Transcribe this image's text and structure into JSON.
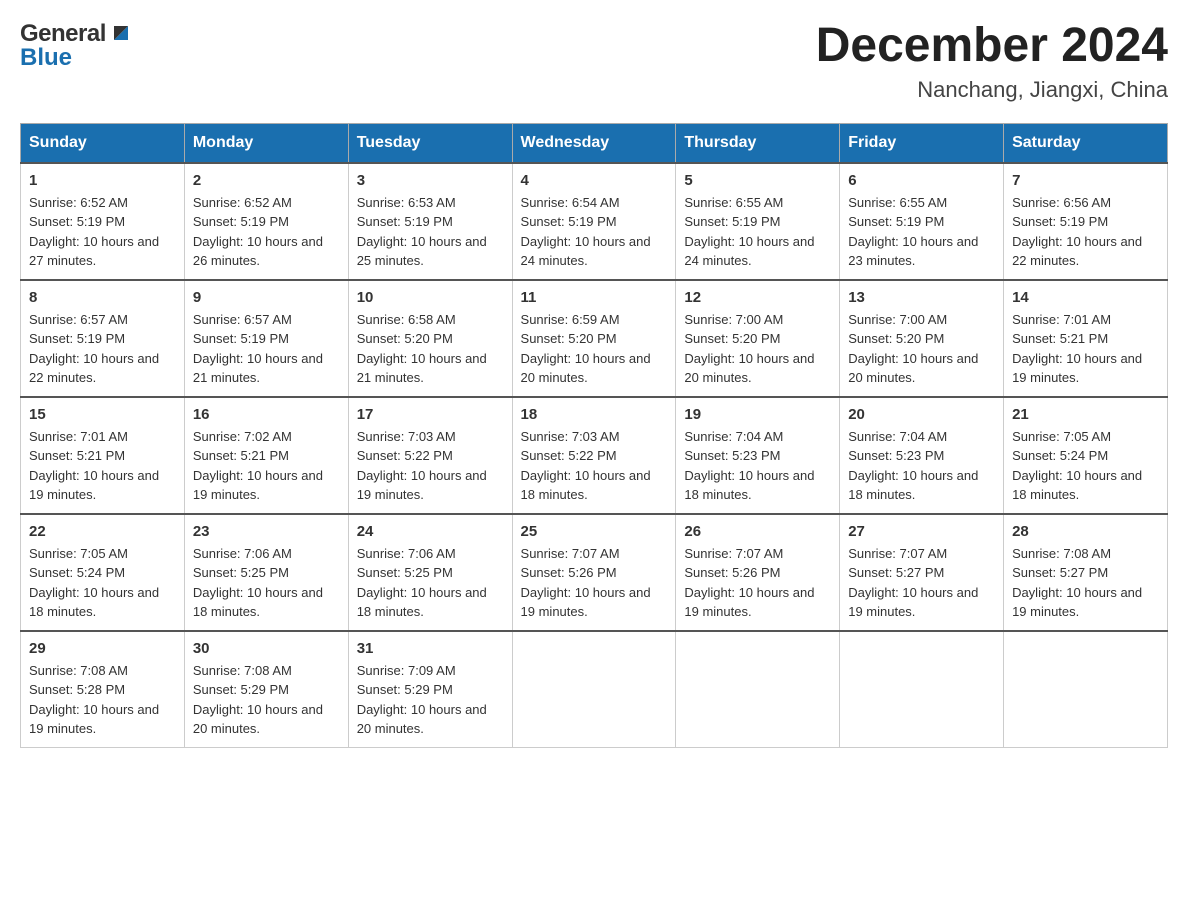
{
  "header": {
    "logo": {
      "general": "General",
      "arrow_symbol": "▶",
      "blue": "Blue"
    },
    "title": "December 2024",
    "location": "Nanchang, Jiangxi, China"
  },
  "calendar": {
    "days_of_week": [
      "Sunday",
      "Monday",
      "Tuesday",
      "Wednesday",
      "Thursday",
      "Friday",
      "Saturday"
    ],
    "weeks": [
      [
        {
          "day": "1",
          "sunrise": "Sunrise: 6:52 AM",
          "sunset": "Sunset: 5:19 PM",
          "daylight": "Daylight: 10 hours and 27 minutes."
        },
        {
          "day": "2",
          "sunrise": "Sunrise: 6:52 AM",
          "sunset": "Sunset: 5:19 PM",
          "daylight": "Daylight: 10 hours and 26 minutes."
        },
        {
          "day": "3",
          "sunrise": "Sunrise: 6:53 AM",
          "sunset": "Sunset: 5:19 PM",
          "daylight": "Daylight: 10 hours and 25 minutes."
        },
        {
          "day": "4",
          "sunrise": "Sunrise: 6:54 AM",
          "sunset": "Sunset: 5:19 PM",
          "daylight": "Daylight: 10 hours and 24 minutes."
        },
        {
          "day": "5",
          "sunrise": "Sunrise: 6:55 AM",
          "sunset": "Sunset: 5:19 PM",
          "daylight": "Daylight: 10 hours and 24 minutes."
        },
        {
          "day": "6",
          "sunrise": "Sunrise: 6:55 AM",
          "sunset": "Sunset: 5:19 PM",
          "daylight": "Daylight: 10 hours and 23 minutes."
        },
        {
          "day": "7",
          "sunrise": "Sunrise: 6:56 AM",
          "sunset": "Sunset: 5:19 PM",
          "daylight": "Daylight: 10 hours and 22 minutes."
        }
      ],
      [
        {
          "day": "8",
          "sunrise": "Sunrise: 6:57 AM",
          "sunset": "Sunset: 5:19 PM",
          "daylight": "Daylight: 10 hours and 22 minutes."
        },
        {
          "day": "9",
          "sunrise": "Sunrise: 6:57 AM",
          "sunset": "Sunset: 5:19 PM",
          "daylight": "Daylight: 10 hours and 21 minutes."
        },
        {
          "day": "10",
          "sunrise": "Sunrise: 6:58 AM",
          "sunset": "Sunset: 5:20 PM",
          "daylight": "Daylight: 10 hours and 21 minutes."
        },
        {
          "day": "11",
          "sunrise": "Sunrise: 6:59 AM",
          "sunset": "Sunset: 5:20 PM",
          "daylight": "Daylight: 10 hours and 20 minutes."
        },
        {
          "day": "12",
          "sunrise": "Sunrise: 7:00 AM",
          "sunset": "Sunset: 5:20 PM",
          "daylight": "Daylight: 10 hours and 20 minutes."
        },
        {
          "day": "13",
          "sunrise": "Sunrise: 7:00 AM",
          "sunset": "Sunset: 5:20 PM",
          "daylight": "Daylight: 10 hours and 20 minutes."
        },
        {
          "day": "14",
          "sunrise": "Sunrise: 7:01 AM",
          "sunset": "Sunset: 5:21 PM",
          "daylight": "Daylight: 10 hours and 19 minutes."
        }
      ],
      [
        {
          "day": "15",
          "sunrise": "Sunrise: 7:01 AM",
          "sunset": "Sunset: 5:21 PM",
          "daylight": "Daylight: 10 hours and 19 minutes."
        },
        {
          "day": "16",
          "sunrise": "Sunrise: 7:02 AM",
          "sunset": "Sunset: 5:21 PM",
          "daylight": "Daylight: 10 hours and 19 minutes."
        },
        {
          "day": "17",
          "sunrise": "Sunrise: 7:03 AM",
          "sunset": "Sunset: 5:22 PM",
          "daylight": "Daylight: 10 hours and 19 minutes."
        },
        {
          "day": "18",
          "sunrise": "Sunrise: 7:03 AM",
          "sunset": "Sunset: 5:22 PM",
          "daylight": "Daylight: 10 hours and 18 minutes."
        },
        {
          "day": "19",
          "sunrise": "Sunrise: 7:04 AM",
          "sunset": "Sunset: 5:23 PM",
          "daylight": "Daylight: 10 hours and 18 minutes."
        },
        {
          "day": "20",
          "sunrise": "Sunrise: 7:04 AM",
          "sunset": "Sunset: 5:23 PM",
          "daylight": "Daylight: 10 hours and 18 minutes."
        },
        {
          "day": "21",
          "sunrise": "Sunrise: 7:05 AM",
          "sunset": "Sunset: 5:24 PM",
          "daylight": "Daylight: 10 hours and 18 minutes."
        }
      ],
      [
        {
          "day": "22",
          "sunrise": "Sunrise: 7:05 AM",
          "sunset": "Sunset: 5:24 PM",
          "daylight": "Daylight: 10 hours and 18 minutes."
        },
        {
          "day": "23",
          "sunrise": "Sunrise: 7:06 AM",
          "sunset": "Sunset: 5:25 PM",
          "daylight": "Daylight: 10 hours and 18 minutes."
        },
        {
          "day": "24",
          "sunrise": "Sunrise: 7:06 AM",
          "sunset": "Sunset: 5:25 PM",
          "daylight": "Daylight: 10 hours and 18 minutes."
        },
        {
          "day": "25",
          "sunrise": "Sunrise: 7:07 AM",
          "sunset": "Sunset: 5:26 PM",
          "daylight": "Daylight: 10 hours and 19 minutes."
        },
        {
          "day": "26",
          "sunrise": "Sunrise: 7:07 AM",
          "sunset": "Sunset: 5:26 PM",
          "daylight": "Daylight: 10 hours and 19 minutes."
        },
        {
          "day": "27",
          "sunrise": "Sunrise: 7:07 AM",
          "sunset": "Sunset: 5:27 PM",
          "daylight": "Daylight: 10 hours and 19 minutes."
        },
        {
          "day": "28",
          "sunrise": "Sunrise: 7:08 AM",
          "sunset": "Sunset: 5:27 PM",
          "daylight": "Daylight: 10 hours and 19 minutes."
        }
      ],
      [
        {
          "day": "29",
          "sunrise": "Sunrise: 7:08 AM",
          "sunset": "Sunset: 5:28 PM",
          "daylight": "Daylight: 10 hours and 19 minutes."
        },
        {
          "day": "30",
          "sunrise": "Sunrise: 7:08 AM",
          "sunset": "Sunset: 5:29 PM",
          "daylight": "Daylight: 10 hours and 20 minutes."
        },
        {
          "day": "31",
          "sunrise": "Sunrise: 7:09 AM",
          "sunset": "Sunset: 5:29 PM",
          "daylight": "Daylight: 10 hours and 20 minutes."
        },
        null,
        null,
        null,
        null
      ]
    ]
  }
}
